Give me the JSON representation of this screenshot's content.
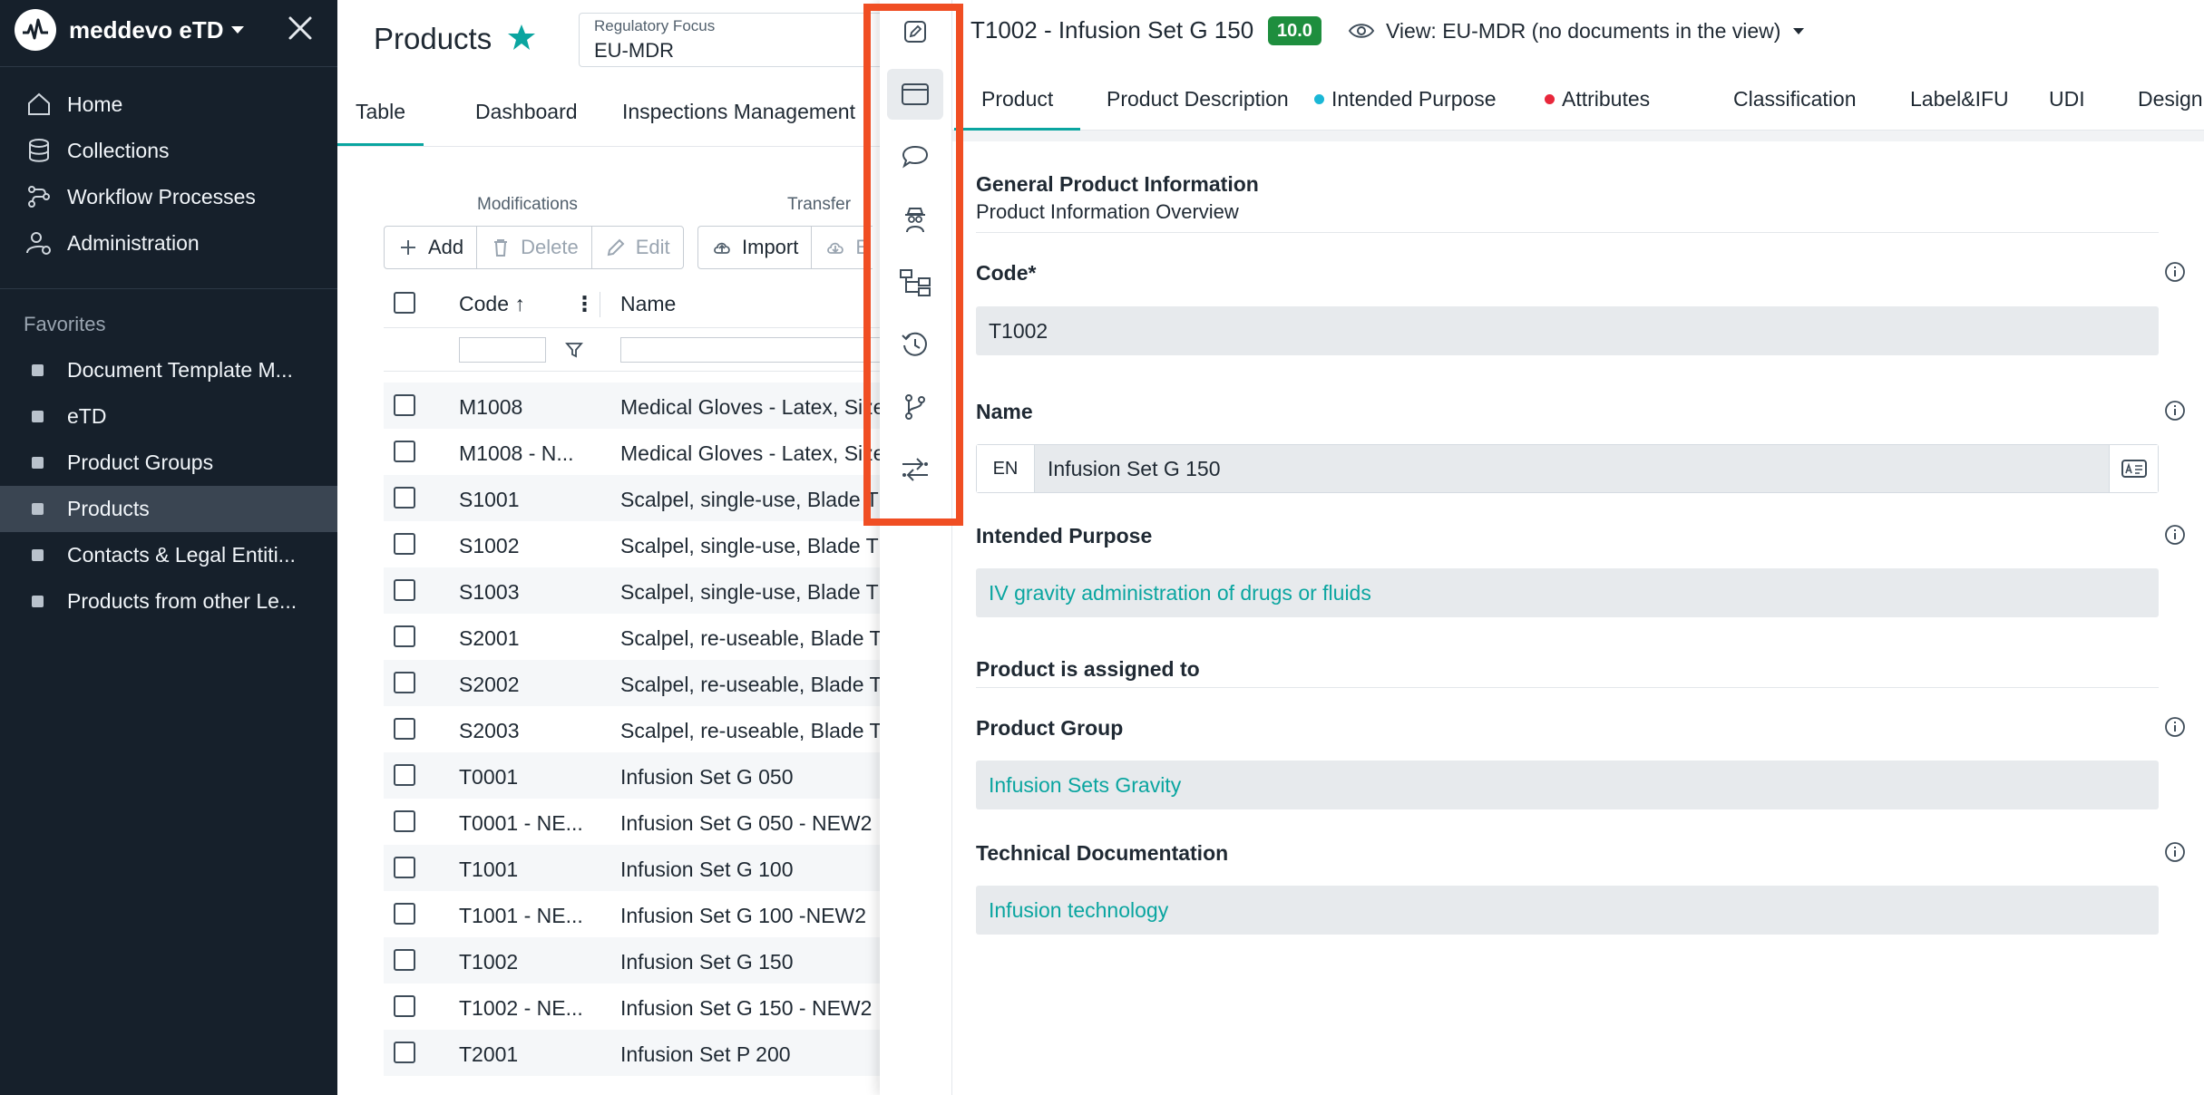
{
  "sidebar": {
    "brand": "meddevo eTD",
    "nav": [
      {
        "label": "Home",
        "icon": "home-icon"
      },
      {
        "label": "Collections",
        "icon": "database-icon"
      },
      {
        "label": "Workflow Processes",
        "icon": "workflow-icon"
      },
      {
        "label": "Administration",
        "icon": "user-settings-icon"
      }
    ],
    "favorites_heading": "Favorites",
    "favorites": [
      {
        "label": "Document Template M...",
        "active": false
      },
      {
        "label": "eTD",
        "active": false
      },
      {
        "label": "Product Groups",
        "active": false
      },
      {
        "label": "Products",
        "active": true
      },
      {
        "label": "Contacts & Legal Entiti...",
        "active": false
      },
      {
        "label": "Products from other Le...",
        "active": false
      }
    ]
  },
  "products_page": {
    "title": "Products",
    "regulatory_focus": {
      "label": "Regulatory Focus",
      "value": "EU-MDR"
    },
    "tabs": [
      "Table",
      "Dashboard",
      "Inspections Management"
    ],
    "active_tab": "Table",
    "toolbar": {
      "modifications_label": "Modifications",
      "transfer_label": "Transfer",
      "add": "Add",
      "delete": "Delete",
      "edit": "Edit",
      "import": "Import",
      "export_partial": "E"
    },
    "columns": {
      "code": "Code",
      "name": "Name"
    },
    "rows": [
      {
        "code": "M1008",
        "name": "Medical Gloves - Latex, Size"
      },
      {
        "code": "M1008 - N...",
        "name": "Medical Gloves - Latex, Size"
      },
      {
        "code": "S1001",
        "name": "Scalpel, single-use, Blade T"
      },
      {
        "code": "S1002",
        "name": "Scalpel, single-use, Blade T"
      },
      {
        "code": "S1003",
        "name": "Scalpel, single-use, Blade T"
      },
      {
        "code": "S2001",
        "name": "Scalpel, re-useable, Blade T"
      },
      {
        "code": "S2002",
        "name": "Scalpel, re-useable, Blade T"
      },
      {
        "code": "S2003",
        "name": "Scalpel, re-useable, Blade T"
      },
      {
        "code": "T0001",
        "name": "Infusion Set G 050"
      },
      {
        "code": "T0001 - NE...",
        "name": "Infusion Set G 050 - NEW2"
      },
      {
        "code": "T1001",
        "name": "Infusion Set G 100"
      },
      {
        "code": "T1001 - NE...",
        "name": "Infusion Set G 100 -NEW2"
      },
      {
        "code": "T1002",
        "name": "Infusion Set G 150"
      },
      {
        "code": "T1002 - NE...",
        "name": "Infusion Set G 150 - NEW2"
      },
      {
        "code": "T2001",
        "name": "Infusion Set P 200"
      }
    ]
  },
  "detail": {
    "title": "T1002 - Infusion Set G 150",
    "version": "10.0",
    "view": "View: EU-MDR (no documents in the view)",
    "rail_icons": [
      "edit-icon",
      "window-icon",
      "comment-icon",
      "inspector-icon",
      "hierarchy-icon",
      "history-icon",
      "branch-icon",
      "transfer-icon"
    ],
    "tabs": [
      {
        "label": "Product",
        "dot": null
      },
      {
        "label": "Product Description",
        "dot": null
      },
      {
        "label": "Intended Purpose",
        "dot": "#1ab7d6"
      },
      {
        "label": "Attributes",
        "dot": "#e8273b"
      },
      {
        "label": "Classification",
        "dot": null
      },
      {
        "label": "Label&IFU",
        "dot": null
      },
      {
        "label": "UDI",
        "dot": null
      },
      {
        "label": "Design",
        "dot": null
      }
    ],
    "section_title": "General Product Information",
    "section_subtitle": "Product Information Overview",
    "code_label": "Code*",
    "code_value": "T1002",
    "name_label": "Name",
    "name_lang": "EN",
    "name_value": "Infusion Set G 150",
    "intended_label": "Intended Purpose",
    "intended_value": "IV gravity administration of drugs or fluids",
    "assigned_title": "Product is assigned to",
    "group_label": "Product Group",
    "group_value": "Infusion Sets Gravity",
    "techdoc_label": "Technical Documentation",
    "techdoc_value": "Infusion technology"
  },
  "colors": {
    "sidebar_bg": "#16202b",
    "accent": "#0aa5a0",
    "badge_green": "#1e8e3e",
    "highlight": "#f04e23"
  }
}
